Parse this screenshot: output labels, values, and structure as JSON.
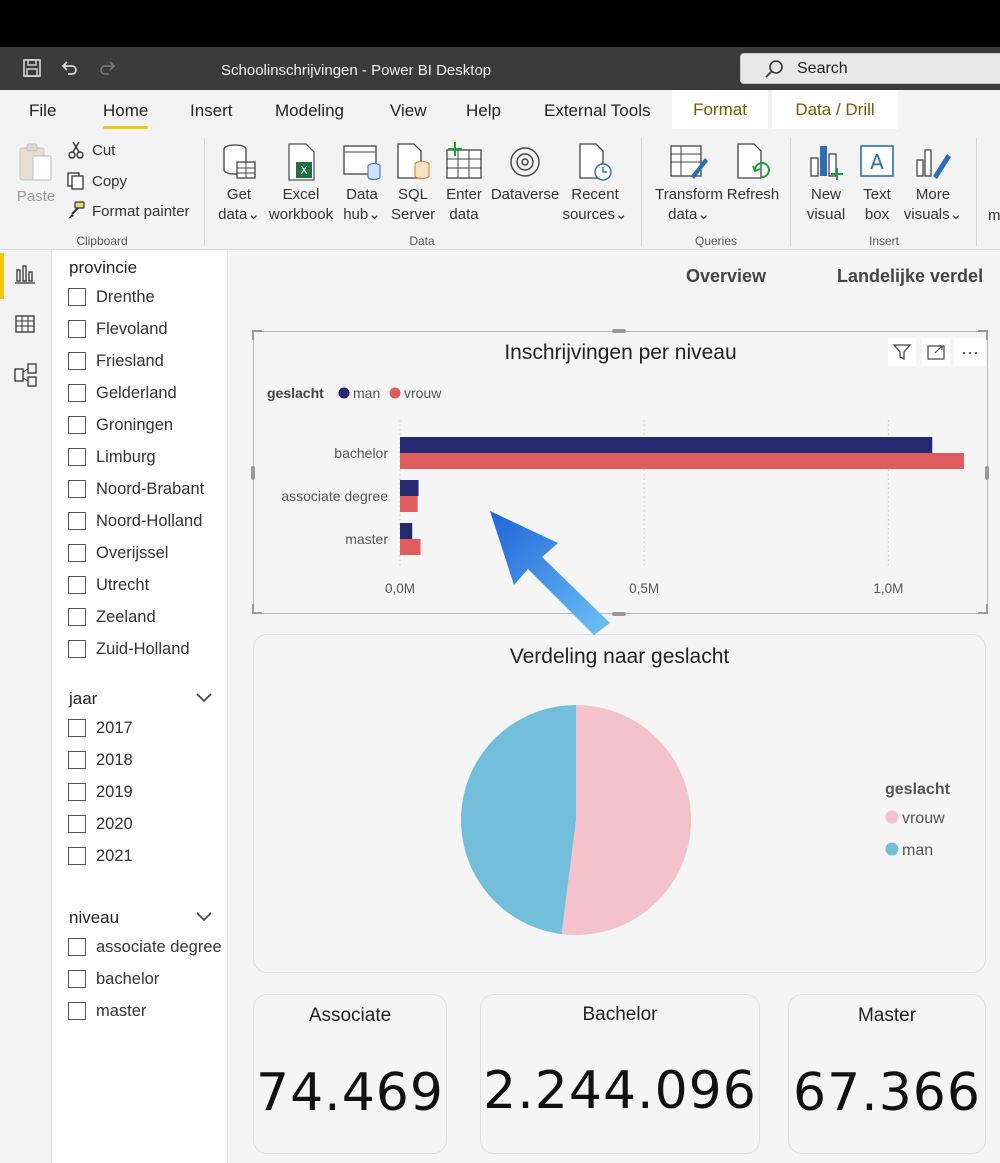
{
  "window": {
    "title": "Schoolinschrijvingen - Power BI Desktop",
    "search_label": "Search"
  },
  "tabs": {
    "file": "File",
    "home": "Home",
    "insert": "Insert",
    "modeling": "Modeling",
    "view": "View",
    "help": "Help",
    "external_tools": "External Tools",
    "format": "Format",
    "data_drill": "Data / Drill"
  },
  "ribbon": {
    "paste": "Paste",
    "cut": "Cut",
    "copy": "Copy",
    "format_painter": "Format painter",
    "clipboard_group": "Clipboard",
    "get_data_1": "Get",
    "get_data_2": "data",
    "excel_1": "Excel",
    "excel_2": "workbook",
    "datahub_1": "Data",
    "datahub_2": "hub",
    "sql_1": "SQL",
    "sql_2": "Server",
    "enter_1": "Enter",
    "enter_2": "data",
    "dataverse": "Dataverse",
    "recent_1": "Recent",
    "recent_2": "sources",
    "data_group": "Data",
    "transform_1": "Transform",
    "transform_2": "data",
    "refresh": "Refresh",
    "queries_group": "Queries",
    "newvisual_1": "New",
    "newvisual_2": "visual",
    "textbox_1": "Text",
    "textbox_2": "box",
    "morevisuals_1": "More",
    "morevisuals_2": "visuals",
    "insert_group": "Insert",
    "cut_off": "m"
  },
  "filters": {
    "provincie": {
      "title": "provincie",
      "items": [
        "Drenthe",
        "Flevoland",
        "Friesland",
        "Gelderland",
        "Groningen",
        "Limburg",
        "Noord-Brabant",
        "Noord-Holland",
        "Overijssel",
        "Utrecht",
        "Zeeland",
        "Zuid-Holland"
      ]
    },
    "jaar": {
      "title": "jaar",
      "items": [
        "2017",
        "2018",
        "2019",
        "2020",
        "2021"
      ]
    },
    "niveau": {
      "title": "niveau",
      "items": [
        "associate degree",
        "bachelor",
        "master"
      ]
    }
  },
  "pages": {
    "overview": "Overview",
    "landelijk": "Landelijke verdel"
  },
  "chart_data": [
    {
      "type": "bar",
      "title": "Inschrijvingen per niveau",
      "legend_title": "geslacht",
      "categories": [
        "bachelor",
        "associate degree",
        "master"
      ],
      "series": [
        {
          "name": "man",
          "color": "#252a6f",
          "values": [
            1090000,
            38000,
            25000
          ]
        },
        {
          "name": "vrouw",
          "color": "#e05c5f",
          "values": [
            1155000,
            36000,
            42000
          ]
        }
      ],
      "xticks": [
        "0,0M",
        "0,5M",
        "1,0M"
      ],
      "xlim": [
        0,
        1200000
      ],
      "legend_position": "top-left"
    },
    {
      "type": "pie",
      "title": "Verdeling naar geslacht",
      "legend_title": "geslacht",
      "slices": [
        {
          "name": "vrouw",
          "color": "#f4c2cb",
          "value": 52
        },
        {
          "name": "man",
          "color": "#72bedb",
          "value": 48
        }
      ],
      "legend_position": "right"
    }
  ],
  "cards": [
    {
      "title": "Associate",
      "value": "74.469"
    },
    {
      "title": "Bachelor",
      "value": "2.244.096"
    },
    {
      "title": "Master",
      "value": "67.366"
    }
  ],
  "colors": {
    "accent": "#f2c811",
    "arrow": "#3f8fe6"
  }
}
